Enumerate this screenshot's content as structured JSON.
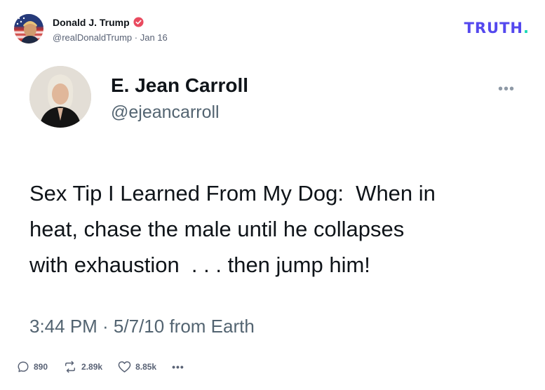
{
  "post": {
    "author_name": "Donald J. Trump",
    "handle": "@realDonaldTrump",
    "separator": "·",
    "date": "Jan 16",
    "brand": "TRUTH",
    "brand_dot": "."
  },
  "embedded_tweet": {
    "name": "E. Jean Carroll",
    "handle": "@ejeancarroll",
    "more": "•••",
    "text": "Sex Tip I Learned From My Dog:  When in\nheat, chase the male until he collapses\nwith exhaustion  . . . then jump him!",
    "timestamp": "3:44 PM · 5/7/10 from Earth"
  },
  "actions": {
    "replies": "890",
    "retruths": "2.89k",
    "likes": "8.85k",
    "more": "•••"
  },
  "colors": {
    "brand": "#5448ee",
    "brand_dot": "#17d8b5",
    "verified": "#e94a5f",
    "muted_text": "#536471"
  }
}
